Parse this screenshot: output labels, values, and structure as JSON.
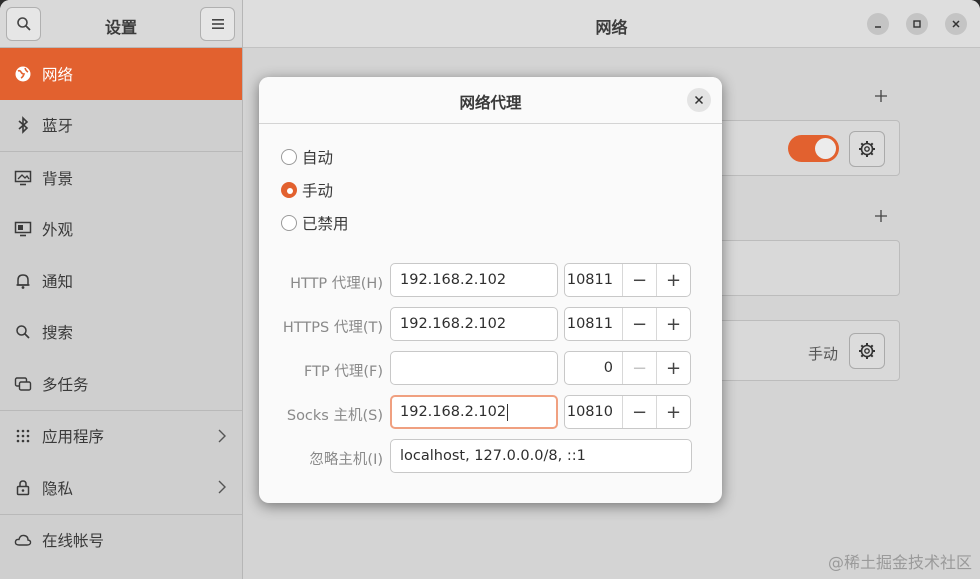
{
  "sidebar": {
    "title": "设置",
    "items": [
      {
        "label": "网络",
        "icon": "globe-icon",
        "active": true
      },
      {
        "label": "蓝牙",
        "icon": "bluetooth-icon"
      },
      {
        "label": "背景",
        "icon": "monitor-icon"
      },
      {
        "label": "外观",
        "icon": "appearance-icon"
      },
      {
        "label": "通知",
        "icon": "bell-icon"
      },
      {
        "label": "搜索",
        "icon": "search-icon"
      },
      {
        "label": "多任务",
        "icon": "multitask-icon"
      },
      {
        "label": "应用程序",
        "icon": "grid-icon"
      },
      {
        "label": "隐私",
        "icon": "lock-icon"
      },
      {
        "label": "在线帐号",
        "icon": "cloud-icon"
      }
    ]
  },
  "main": {
    "title": "网络",
    "proxy_mode": "手动"
  },
  "dialog": {
    "title": "网络代理",
    "modes": [
      {
        "label": "自动",
        "selected": false
      },
      {
        "label": "手动",
        "selected": true
      },
      {
        "label": "已禁用",
        "selected": false
      }
    ],
    "http": {
      "label": "HTTP 代理(H)",
      "host": "192.168.2.102",
      "port": "10811"
    },
    "https": {
      "label": "HTTPS 代理(T)",
      "host": "192.168.2.102",
      "port": "10811"
    },
    "ftp": {
      "label": "FTP 代理(F)",
      "host": "",
      "port": "0"
    },
    "socks": {
      "label": "Socks 主机(S)",
      "host": "192.168.2.102",
      "port": "10810"
    },
    "ignore": {
      "label": "忽略主机(I)",
      "value": "localhost, 127.0.0.0/8, ::1"
    }
  },
  "watermark": "@稀土掘金技术社区",
  "colors": {
    "accent": "#e2612f"
  }
}
